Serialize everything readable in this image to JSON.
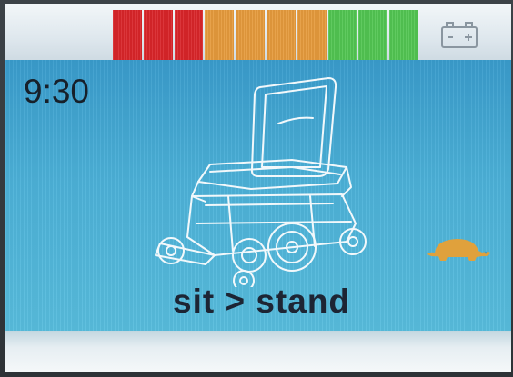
{
  "status_bar": {
    "battery_segments": [
      {
        "color": "#d8252a"
      },
      {
        "color": "#d8252a"
      },
      {
        "color": "#d8252a"
      },
      {
        "color": "#e59a3c"
      },
      {
        "color": "#e59a3c"
      },
      {
        "color": "#e59a3c"
      },
      {
        "color": "#e59a3c"
      },
      {
        "color": "#52c552"
      },
      {
        "color": "#52c552"
      },
      {
        "color": "#52c552"
      }
    ],
    "battery_level": 1.0,
    "battery_icon": "battery-icon"
  },
  "main": {
    "time": "9:30",
    "illustration": "power-wheelchair-icon",
    "speed_icon": "turtle-icon",
    "speed_icon_color": "#e0a13c",
    "mode": "sit > stand"
  }
}
